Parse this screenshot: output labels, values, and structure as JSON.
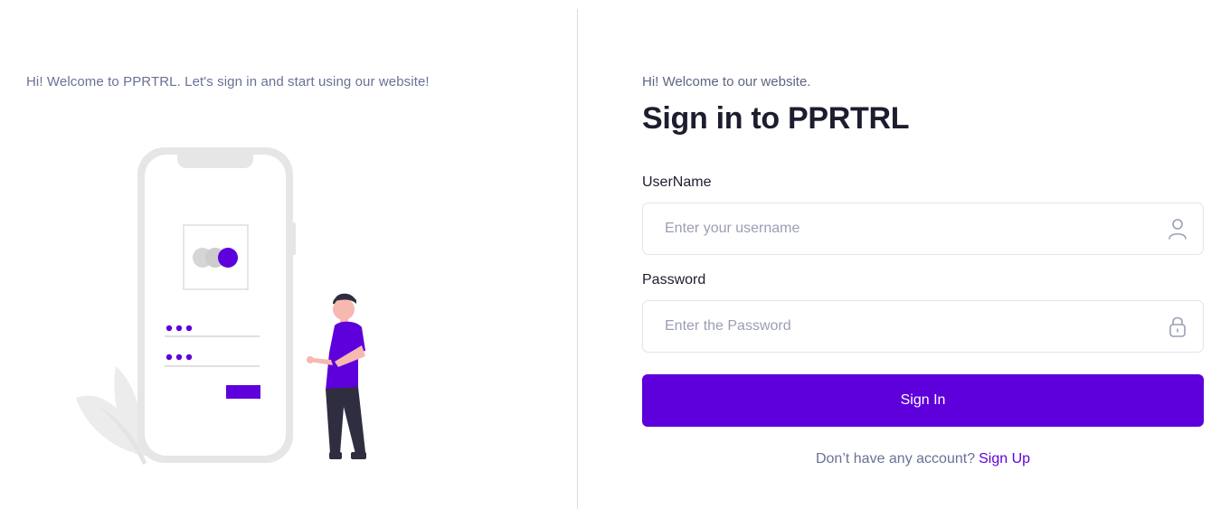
{
  "left_panel": {
    "welcome_text": "Hi! Welcome to PPRTRL. Let's sign in and start using our website!"
  },
  "form": {
    "subtitle": "Hi! Welcome to our website.",
    "title": "Sign in to PPRTRL",
    "username_label": "UserName",
    "username_placeholder": "Enter your username",
    "username_value": "",
    "username_icon": "user-icon",
    "password_label": "Password",
    "password_placeholder": "Enter the Password",
    "password_value": "",
    "password_icon": "lock-icon",
    "signin_label": "Sign In",
    "signup_prompt": "Don’t have any account?",
    "signup_link": "Sign Up"
  },
  "colors": {
    "accent": "#5e00db",
    "divider": "#d9dbe6",
    "muted_text": "#6b7194",
    "heading": "#1c1d2e",
    "input_border": "#e2e4ec"
  }
}
